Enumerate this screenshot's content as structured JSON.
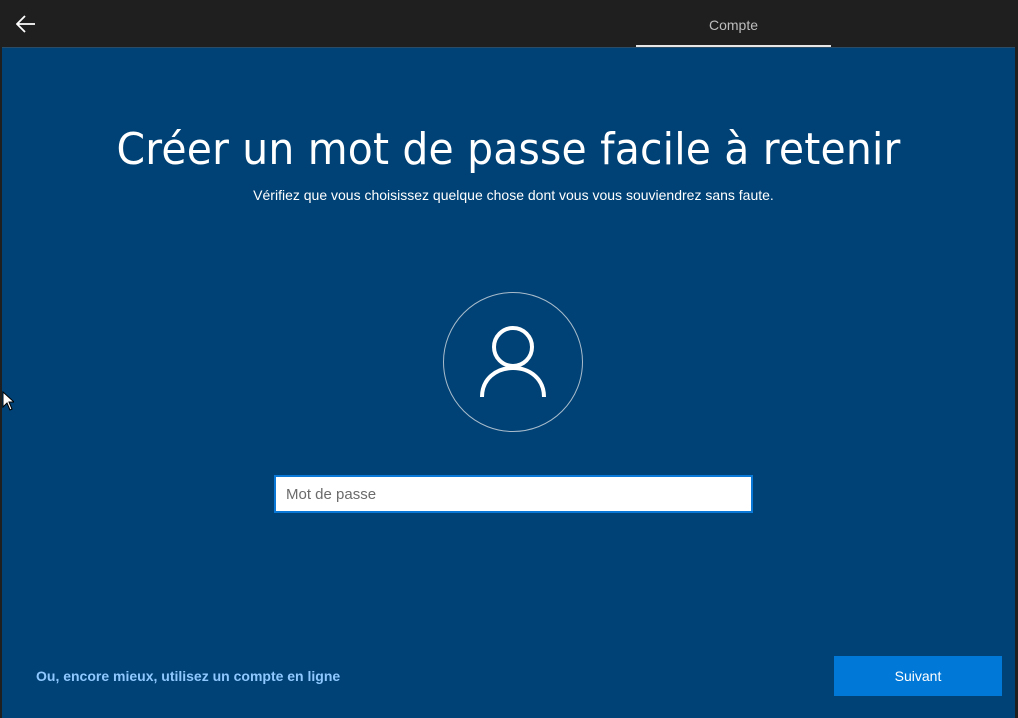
{
  "header": {
    "back_icon": "back-arrow-icon",
    "tab_label": "Compte"
  },
  "main": {
    "title": "Créer un mot de passe facile à retenir",
    "subtitle": "Vérifiez que vous choisissez quelque chose dont vous vous souviendrez sans faute.",
    "avatar_icon": "user-icon",
    "password_placeholder": "Mot de passe",
    "password_value": ""
  },
  "footer": {
    "online_account_link": "Ou, encore mieux, utilisez un compte en ligne",
    "next_button": "Suivant"
  },
  "colors": {
    "background": "#004275",
    "topbar": "#1f1f1f",
    "accent": "#0078d7",
    "link": "#8ec8ff"
  }
}
